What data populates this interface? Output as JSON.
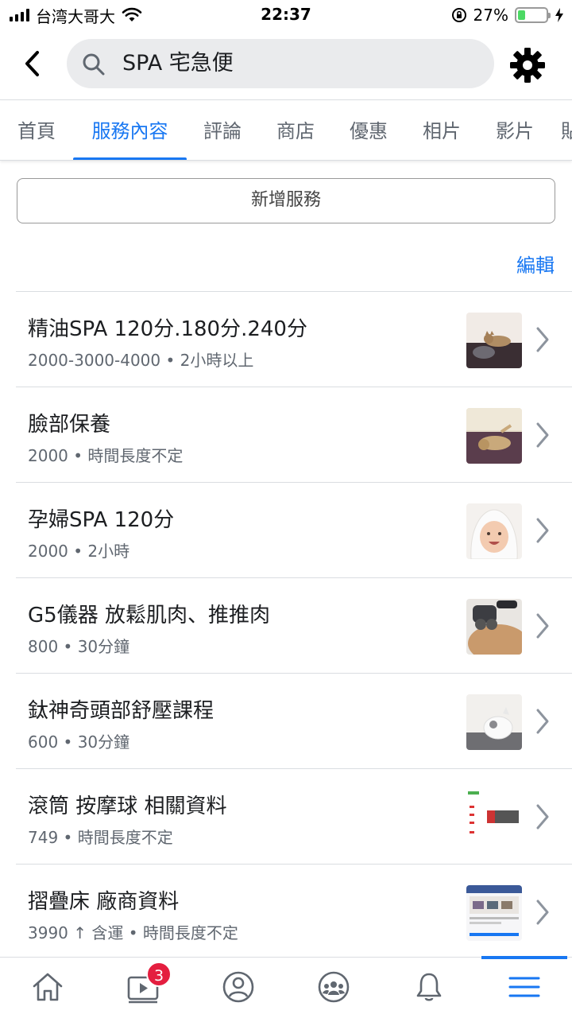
{
  "status_bar": {
    "carrier": "台湾大哥大",
    "time": "22:37",
    "battery_percent": "27%",
    "battery_level": 0.27
  },
  "header": {
    "back_icon": "chevron-left-icon",
    "search_text": "SPA 宅急便",
    "settings_icon": "gear-icon"
  },
  "tabs": [
    {
      "label": "首頁",
      "active": false
    },
    {
      "label": "服務內容",
      "active": true
    },
    {
      "label": "評論",
      "active": false
    },
    {
      "label": "商店",
      "active": false
    },
    {
      "label": "優惠",
      "active": false
    },
    {
      "label": "相片",
      "active": false
    },
    {
      "label": "影片",
      "active": false
    },
    {
      "label": "貼",
      "active": false
    }
  ],
  "add_service_label": "新增服務",
  "edit_label": "編輯",
  "services": [
    {
      "title": "精油SPA 120分.180分.240分",
      "price": "2000-3000-4000",
      "duration": "2小時以上",
      "thumb": "cat-on-blanket"
    },
    {
      "title": "臉部保養",
      "price": "2000",
      "duration": "時間長度不定",
      "thumb": "cat-lying"
    },
    {
      "title": "孕婦SPA 120分",
      "price": "2000",
      "duration": "2小時",
      "thumb": "baby-towel"
    },
    {
      "title": "G5儀器 放鬆肌肉、推推肉",
      "price": "800",
      "duration": "30分鐘",
      "thumb": "massage-device"
    },
    {
      "title": "鈦神奇頭部舒壓課程",
      "price": "600",
      "duration": "30分鐘",
      "thumb": "cat-sleeping"
    },
    {
      "title": "滾筒 按摩球 相關資料",
      "price": "749",
      "duration": "時間長度不定",
      "thumb": "product-page"
    },
    {
      "title": "摺疊床 廠商資料",
      "price": "3990 ↑ 含運",
      "duration": "時間長度不定",
      "thumb": "vendor-page"
    }
  ],
  "bottom_nav": {
    "items": [
      "home-icon",
      "video-icon",
      "profile-icon",
      "groups-icon",
      "bell-icon",
      "menu-icon"
    ],
    "active": "menu-icon",
    "video_badge": "3"
  },
  "colors": {
    "accent": "#1877f2",
    "badge": "#e41e3f",
    "battery": "#4cd964"
  }
}
